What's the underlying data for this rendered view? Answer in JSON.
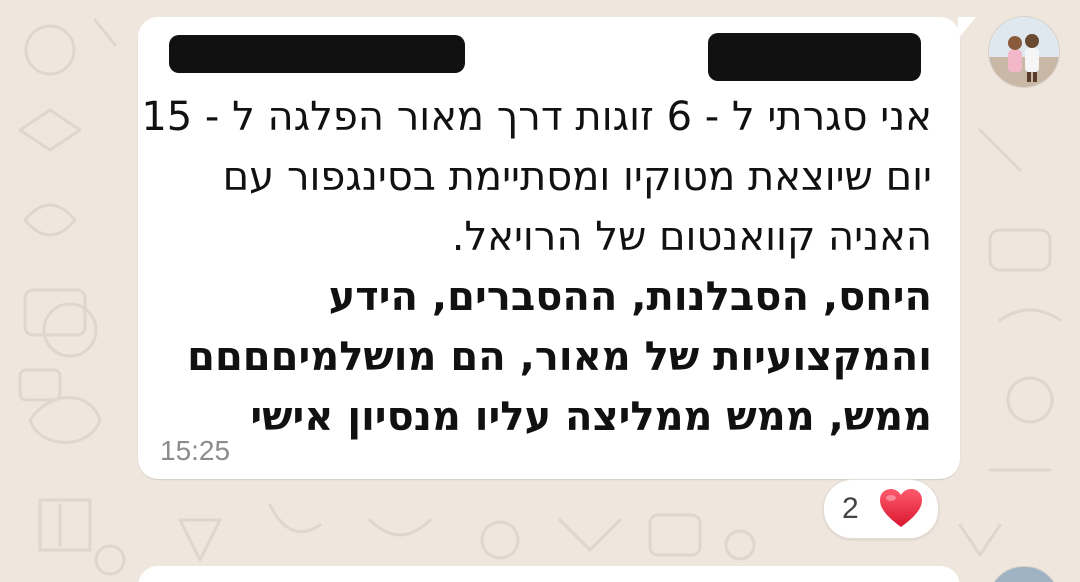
{
  "message": {
    "lines": [
      "אני סגרתי ל - 6 זוגות דרך מאור הפלגה ל - 15",
      "יום שיוצאת מטוקיו ומסתיימת בסינגפור עם",
      "האניה קוואנטום של הרויאל.",
      "היחס, הסבלנות, ההסברים, הידע",
      "והמקצועיות של מאור, הם מושלמיםםםם",
      "ממש, ממש ממליצה עליו מנסיון אישי"
    ],
    "time": "15:25"
  },
  "reaction": {
    "count": "2",
    "emoji_icon": "red-heart-icon"
  },
  "colors": {
    "chat_background": "#efe7dd",
    "bubble": "#ffffff",
    "sender_name": "#2c8f68",
    "timestamp": "#8c8c8c",
    "heart": "#e3243b"
  }
}
